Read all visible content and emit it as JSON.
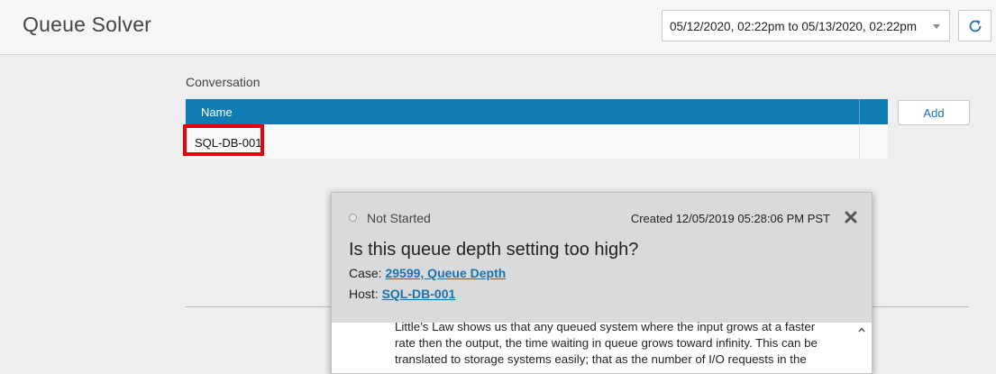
{
  "header": {
    "title": "Queue Solver",
    "date_range": "05/12/2020, 02:22pm to 05/13/2020, 02:22pm"
  },
  "conversation": {
    "section_label": "Conversation",
    "columns": [
      "Name"
    ],
    "rows": [
      {
        "name": "SQL-DB-001"
      }
    ],
    "add_label": "Add"
  },
  "popup": {
    "status": "Not Started",
    "created": "Created 12/05/2019 05:28:06 PM PST",
    "question": "Is this queue depth setting too high?",
    "case_label": "Case:",
    "case_value": "29599, Queue Depth",
    "host_label": "Host:",
    "host_value": "SQL-DB-001",
    "body_lines": [
      "Little’s Law shows us that any queued system where the input grows at a faster",
      "rate then the output, the time waiting in queue grows toward infinity. This can be",
      "translated to storage systems easily; that as the number of I/O requests in the"
    ]
  },
  "colors": {
    "table_header": "#0f7cb3",
    "link": "#1a73ad",
    "highlight": "#e8000b"
  }
}
